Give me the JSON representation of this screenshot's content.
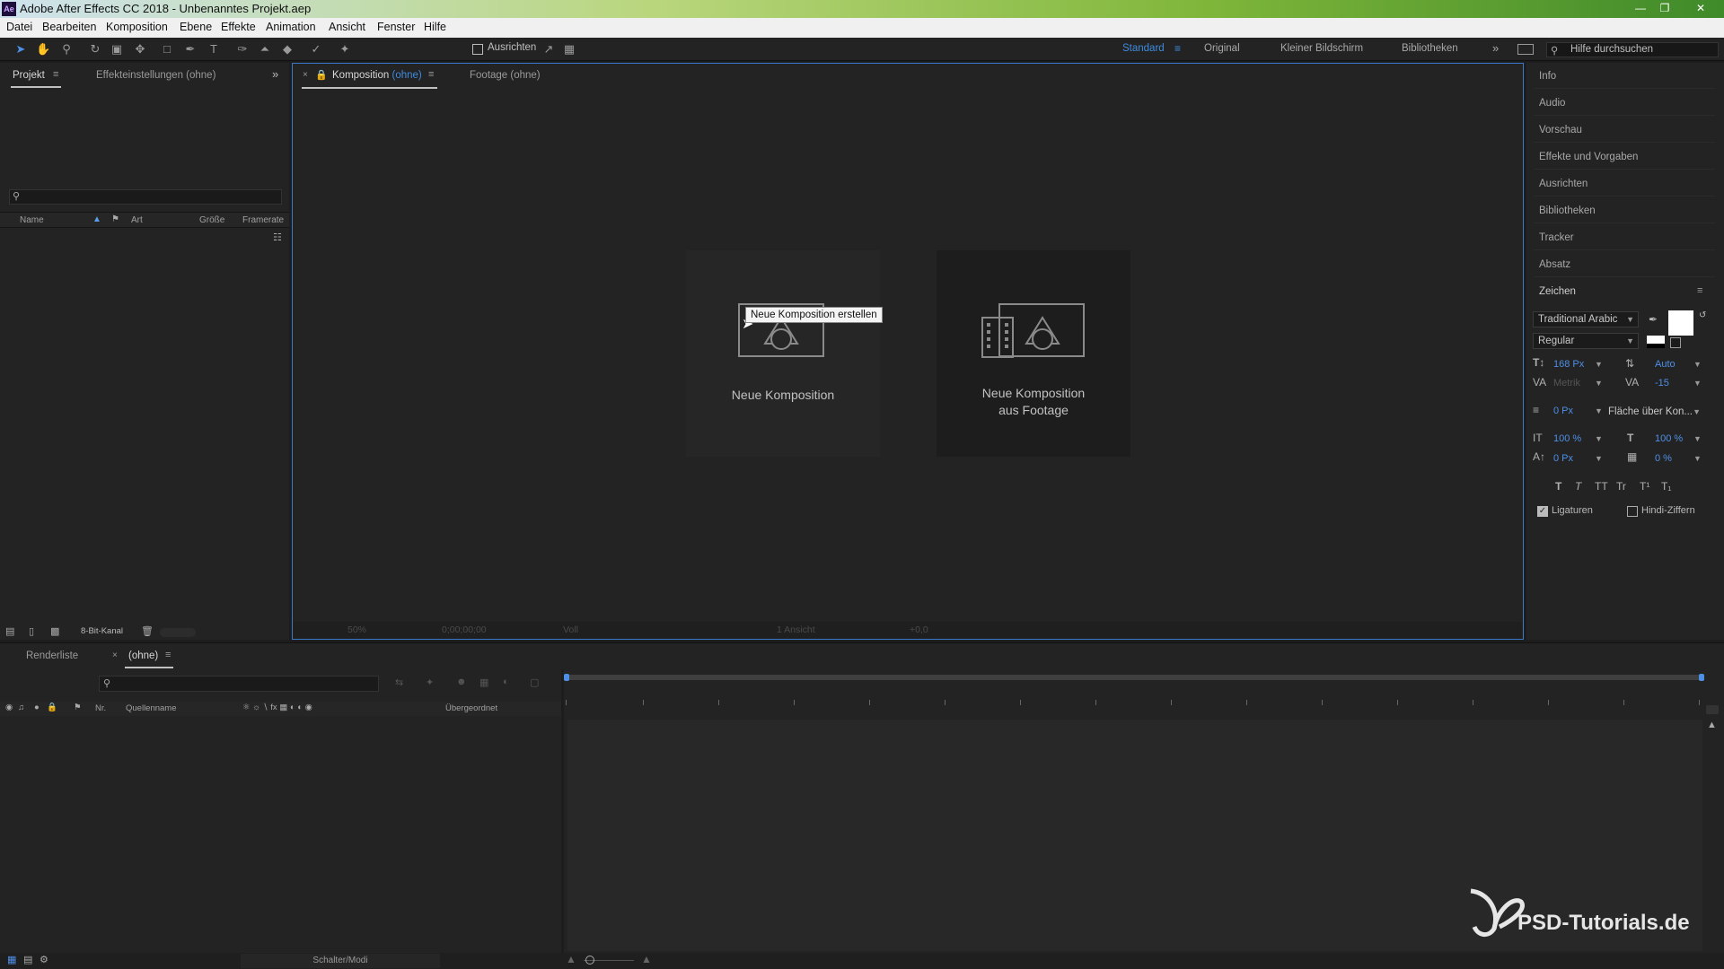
{
  "window": {
    "title": "Adobe After Effects CC 2018 - Unbenanntes Projekt.aep",
    "app_icon": "Ae"
  },
  "menu": [
    "Datei",
    "Bearbeiten",
    "Komposition",
    "Ebene",
    "Effekte",
    "Animation",
    "Ansicht",
    "Fenster",
    "Hilfe"
  ],
  "toolbar": {
    "snap_label": "Ausrichten",
    "workspaces": [
      "Standard",
      "Original",
      "Kleiner Bildschirm",
      "Bibliotheken"
    ],
    "active_workspace": "Standard",
    "help_placeholder": "Hilfe durchsuchen"
  },
  "project_panel": {
    "tabs": [
      "Projekt",
      "Effekteinstellungen (ohne)"
    ],
    "columns": [
      "Name",
      "Art",
      "Größe",
      "Framerate"
    ],
    "bit_depth": "8-Bit-Kanal"
  },
  "comp_panel": {
    "tab_prefix": "Komposition",
    "tab_suffix": "(ohne)",
    "footage_tab": "Footage (ohne)",
    "card1_label": "Neue Komposition",
    "card2_line1": "Neue Komposition",
    "card2_line2": "aus Footage",
    "tooltip": "Neue Komposition erstellen",
    "footer": {
      "zoom": "50%",
      "timecode": "0;00;00;00",
      "resolution": "Voll",
      "views": "1 Ansicht",
      "exposure": "+0,0"
    }
  },
  "right_panel": {
    "items": [
      "Info",
      "Audio",
      "Vorschau",
      "Effekte und Vorgaben",
      "Ausrichten",
      "Bibliotheken",
      "Tracker",
      "Absatz"
    ],
    "zeichen": {
      "title": "Zeichen",
      "font": "Traditional Arabic",
      "style": "Regular",
      "size": "168 Px",
      "leading": "Auto",
      "kerning": "Metrik",
      "tracking": "-15",
      "stroke_width": "0 Px",
      "stroke_mode": "Fläche über Kon...",
      "vert_scale": "100 %",
      "horiz_scale": "100 %",
      "baseline": "0 Px",
      "tsume": "0 %",
      "ligatures": "Ligaturen",
      "hindi": "Hindi-Ziffern"
    }
  },
  "timeline": {
    "tabs": [
      "Renderliste",
      "(ohne)"
    ],
    "columns": [
      "Nr.",
      "Quellenname",
      "Übergeordnet"
    ],
    "footer_label": "Schalter/Modi"
  },
  "watermark": "PSD-Tutorials.de",
  "colors": {
    "accent": "#3e8bdf",
    "panel": "#232323",
    "active_border": "#3a79c8"
  }
}
